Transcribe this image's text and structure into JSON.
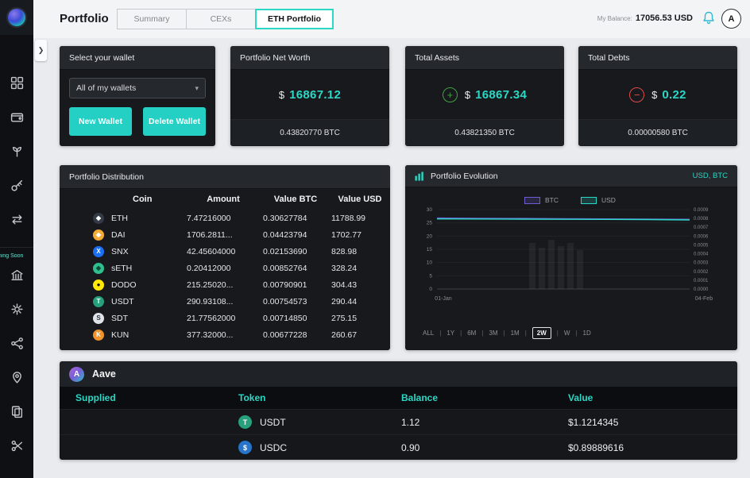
{
  "header": {
    "title": "Portfolio",
    "tabs": [
      {
        "label": "Summary",
        "active": false
      },
      {
        "label": "CEXs",
        "active": false
      },
      {
        "label": "ETH Portfolio",
        "active": true
      }
    ],
    "balance_label": "My Balance:",
    "balance_value": "17056.53 USD",
    "avatar_letter": "A"
  },
  "sidebar": {
    "coming_soon_label": "Coming Soon"
  },
  "icons": {
    "collapse_chevron": "❯",
    "dropdown_caret": "▾",
    "assets_plus": "+",
    "debts_minus": "−"
  },
  "wallet_card": {
    "title": "Select your wallet",
    "dropdown_value": "All of my wallets",
    "new_wallet_label": "New Wallet",
    "delete_wallet_label": "Delete Wallet"
  },
  "net_worth_card": {
    "title": "Portfolio Net Worth",
    "currency": "$",
    "value": "16867.12",
    "btc_value": "0.43820770 BTC"
  },
  "assets_card": {
    "title": "Total Assets",
    "currency": "$",
    "value": "16867.34",
    "btc_value": "0.43821350 BTC"
  },
  "debts_card": {
    "title": "Total Debts",
    "currency": "$",
    "value": "0.22",
    "btc_value": "0.00000580 BTC"
  },
  "distribution": {
    "title": "Portfolio Distribution",
    "columns": [
      "Coin",
      "Amount",
      "Value BTC",
      "Value USD"
    ],
    "rows": [
      {
        "coin": "ETH",
        "symbol": "◆",
        "icon_bg": "#343a46",
        "icon_fg": "#ffffff",
        "amount": "7.47216000",
        "value_btc": "0.30627784",
        "value_usd": "11788.99"
      },
      {
        "coin": "DAI",
        "symbol": "◆",
        "icon_bg": "#f5ac37",
        "icon_fg": "#ffffff",
        "amount": "1706.2811...",
        "value_btc": "0.04423794",
        "value_usd": "1702.77"
      },
      {
        "coin": "SNX",
        "symbol": "X",
        "icon_bg": "#1a6ff5",
        "icon_fg": "#ffffff",
        "amount": "42.45604000",
        "value_btc": "0.02153690",
        "value_usd": "828.98"
      },
      {
        "coin": "sETH",
        "symbol": "◆",
        "icon_bg": "#2fbf8f",
        "icon_fg": "#0d4d3a",
        "amount": "0.20412000",
        "value_btc": "0.00852764",
        "value_usd": "328.24"
      },
      {
        "coin": "DODO",
        "symbol": "●",
        "icon_bg": "#ffe804",
        "icon_fg": "#111111",
        "amount": "215.25020...",
        "value_btc": "0.00790901",
        "value_usd": "304.43"
      },
      {
        "coin": "USDT",
        "symbol": "T",
        "icon_bg": "#26a17b",
        "icon_fg": "#ffffff",
        "amount": "290.93108...",
        "value_btc": "0.00754573",
        "value_usd": "290.44"
      },
      {
        "coin": "SDT",
        "symbol": "S",
        "icon_bg": "#dfe3ea",
        "icon_fg": "#30343b",
        "amount": "21.77562000",
        "value_btc": "0.00714850",
        "value_usd": "275.15"
      },
      {
        "coin": "KUN",
        "symbol": "K",
        "icon_bg": "#f0932b",
        "icon_fg": "#ffffff",
        "amount": "377.32000...",
        "value_btc": "0.00677228",
        "value_usd": "260.67"
      }
    ]
  },
  "evolution": {
    "title": "Portfolio Evolution",
    "units": "USD, BTC",
    "legend": [
      {
        "label": "BTC",
        "color": "#6c5dd3"
      },
      {
        "label": "USD",
        "color": "#2bd7c5"
      }
    ],
    "ranges": [
      "ALL",
      "1Y",
      "6M",
      "3M",
      "1M",
      "2W",
      "W",
      "1D"
    ],
    "active_range": "2W"
  },
  "chart_data": {
    "type": "line",
    "title": "Portfolio Evolution",
    "x_labels": [
      "01-Jan",
      "04-Feb"
    ],
    "left_axis": {
      "range": [
        0,
        30
      ],
      "ticks": [
        30,
        25,
        20,
        15,
        10,
        5,
        0
      ]
    },
    "right_axis": {
      "range": [
        0,
        0.0009
      ],
      "ticks": [
        0.0009,
        0.0008,
        0.0007,
        0.0006,
        0.0005,
        0.0004,
        0.0003,
        0.0002,
        0.0001,
        0.0
      ]
    },
    "series": [
      {
        "name": "BTC",
        "axis": "right",
        "color": "#6c5dd3",
        "values": [
          0.000805,
          0.000802,
          0.0008,
          0.000797,
          0.000795,
          0.000792,
          0.00079
        ]
      },
      {
        "name": "USD",
        "axis": "left",
        "color": "#2bd7c5",
        "values": [
          26.5,
          26.45,
          26.4,
          26.35,
          26.3,
          26.25,
          26.1
        ]
      }
    ]
  },
  "aave": {
    "name": "Aave",
    "logo_letter": "A",
    "columns": [
      "Supplied",
      "Token",
      "Balance",
      "Value"
    ],
    "rows": [
      {
        "token": "USDT",
        "symbol": "T",
        "icon_bg": "#26a17b",
        "icon_fg": "#ffffff",
        "balance": "1.12",
        "value": "$1.1214345"
      },
      {
        "token": "USDC",
        "symbol": "$",
        "icon_bg": "#2775ca",
        "icon_fg": "#ffffff",
        "balance": "0.90",
        "value": "$0.89889616"
      }
    ]
  }
}
